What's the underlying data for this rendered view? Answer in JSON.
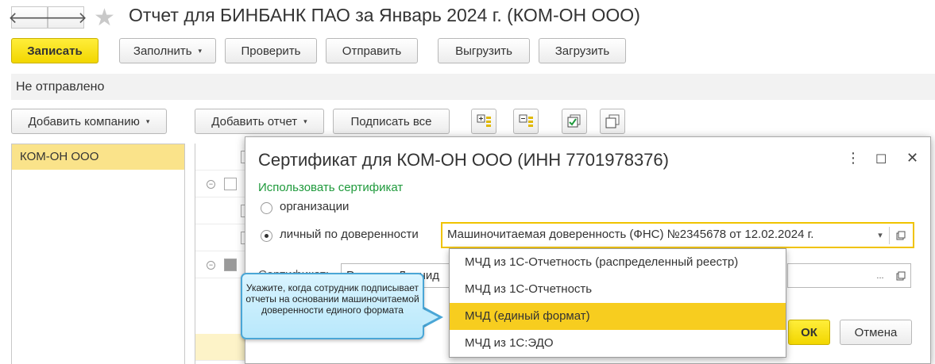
{
  "window": {
    "title": "Отчет для БИНБАНК ПАО за Январь 2024 г. (КОМ-ОН ООО)",
    "back_glyph": "🡐",
    "forward_glyph": "🡒",
    "star_glyph": "★"
  },
  "toolbar": {
    "write": "Записать",
    "fill": "Заполнить",
    "check": "Проверить",
    "send": "Отправить",
    "export": "Выгрузить",
    "import": "Загрузить"
  },
  "status": "Не отправлено",
  "actions": {
    "add_company": "Добавить компанию",
    "add_report": "Добавить отчет",
    "sign_all": "Подписать все"
  },
  "companies": [
    "КОМ-ОН ООО"
  ],
  "dialog": {
    "title": "Сертификат для КОМ-ОН ООО (ИНН 7701978376)",
    "use_cert_label": "Использовать сертификат",
    "radio_org": "организации",
    "radio_personal": "личный по доверенности",
    "poa_value": "Машиночитаемая доверенность (ФНС) №2345678 от 12.02.2024 г.",
    "cert_label": "Сертификат:",
    "cert_value": "Романов Леонид",
    "ok": "ОК",
    "cancel": "Отмена",
    "menu_glyph": "⋮",
    "max_glyph": "☐",
    "close_glyph": "✕"
  },
  "dropdown_options": [
    "МЧД из 1С-Отчетность (распределенный реестр)",
    "МЧД из 1С-Отчетность",
    "МЧД (единый формат)",
    "МЧД из 1С:ЭДО"
  ],
  "tooltip": "Укажите, когда сотрудник подписывает отчеты на основании машиночитаемой доверенности единого формата",
  "colors": {
    "accent_yellow": "#f7cd1f",
    "selection": "#fae38a",
    "green_label": "#1f9a3c",
    "tooltip_border": "#4aa6d6"
  }
}
